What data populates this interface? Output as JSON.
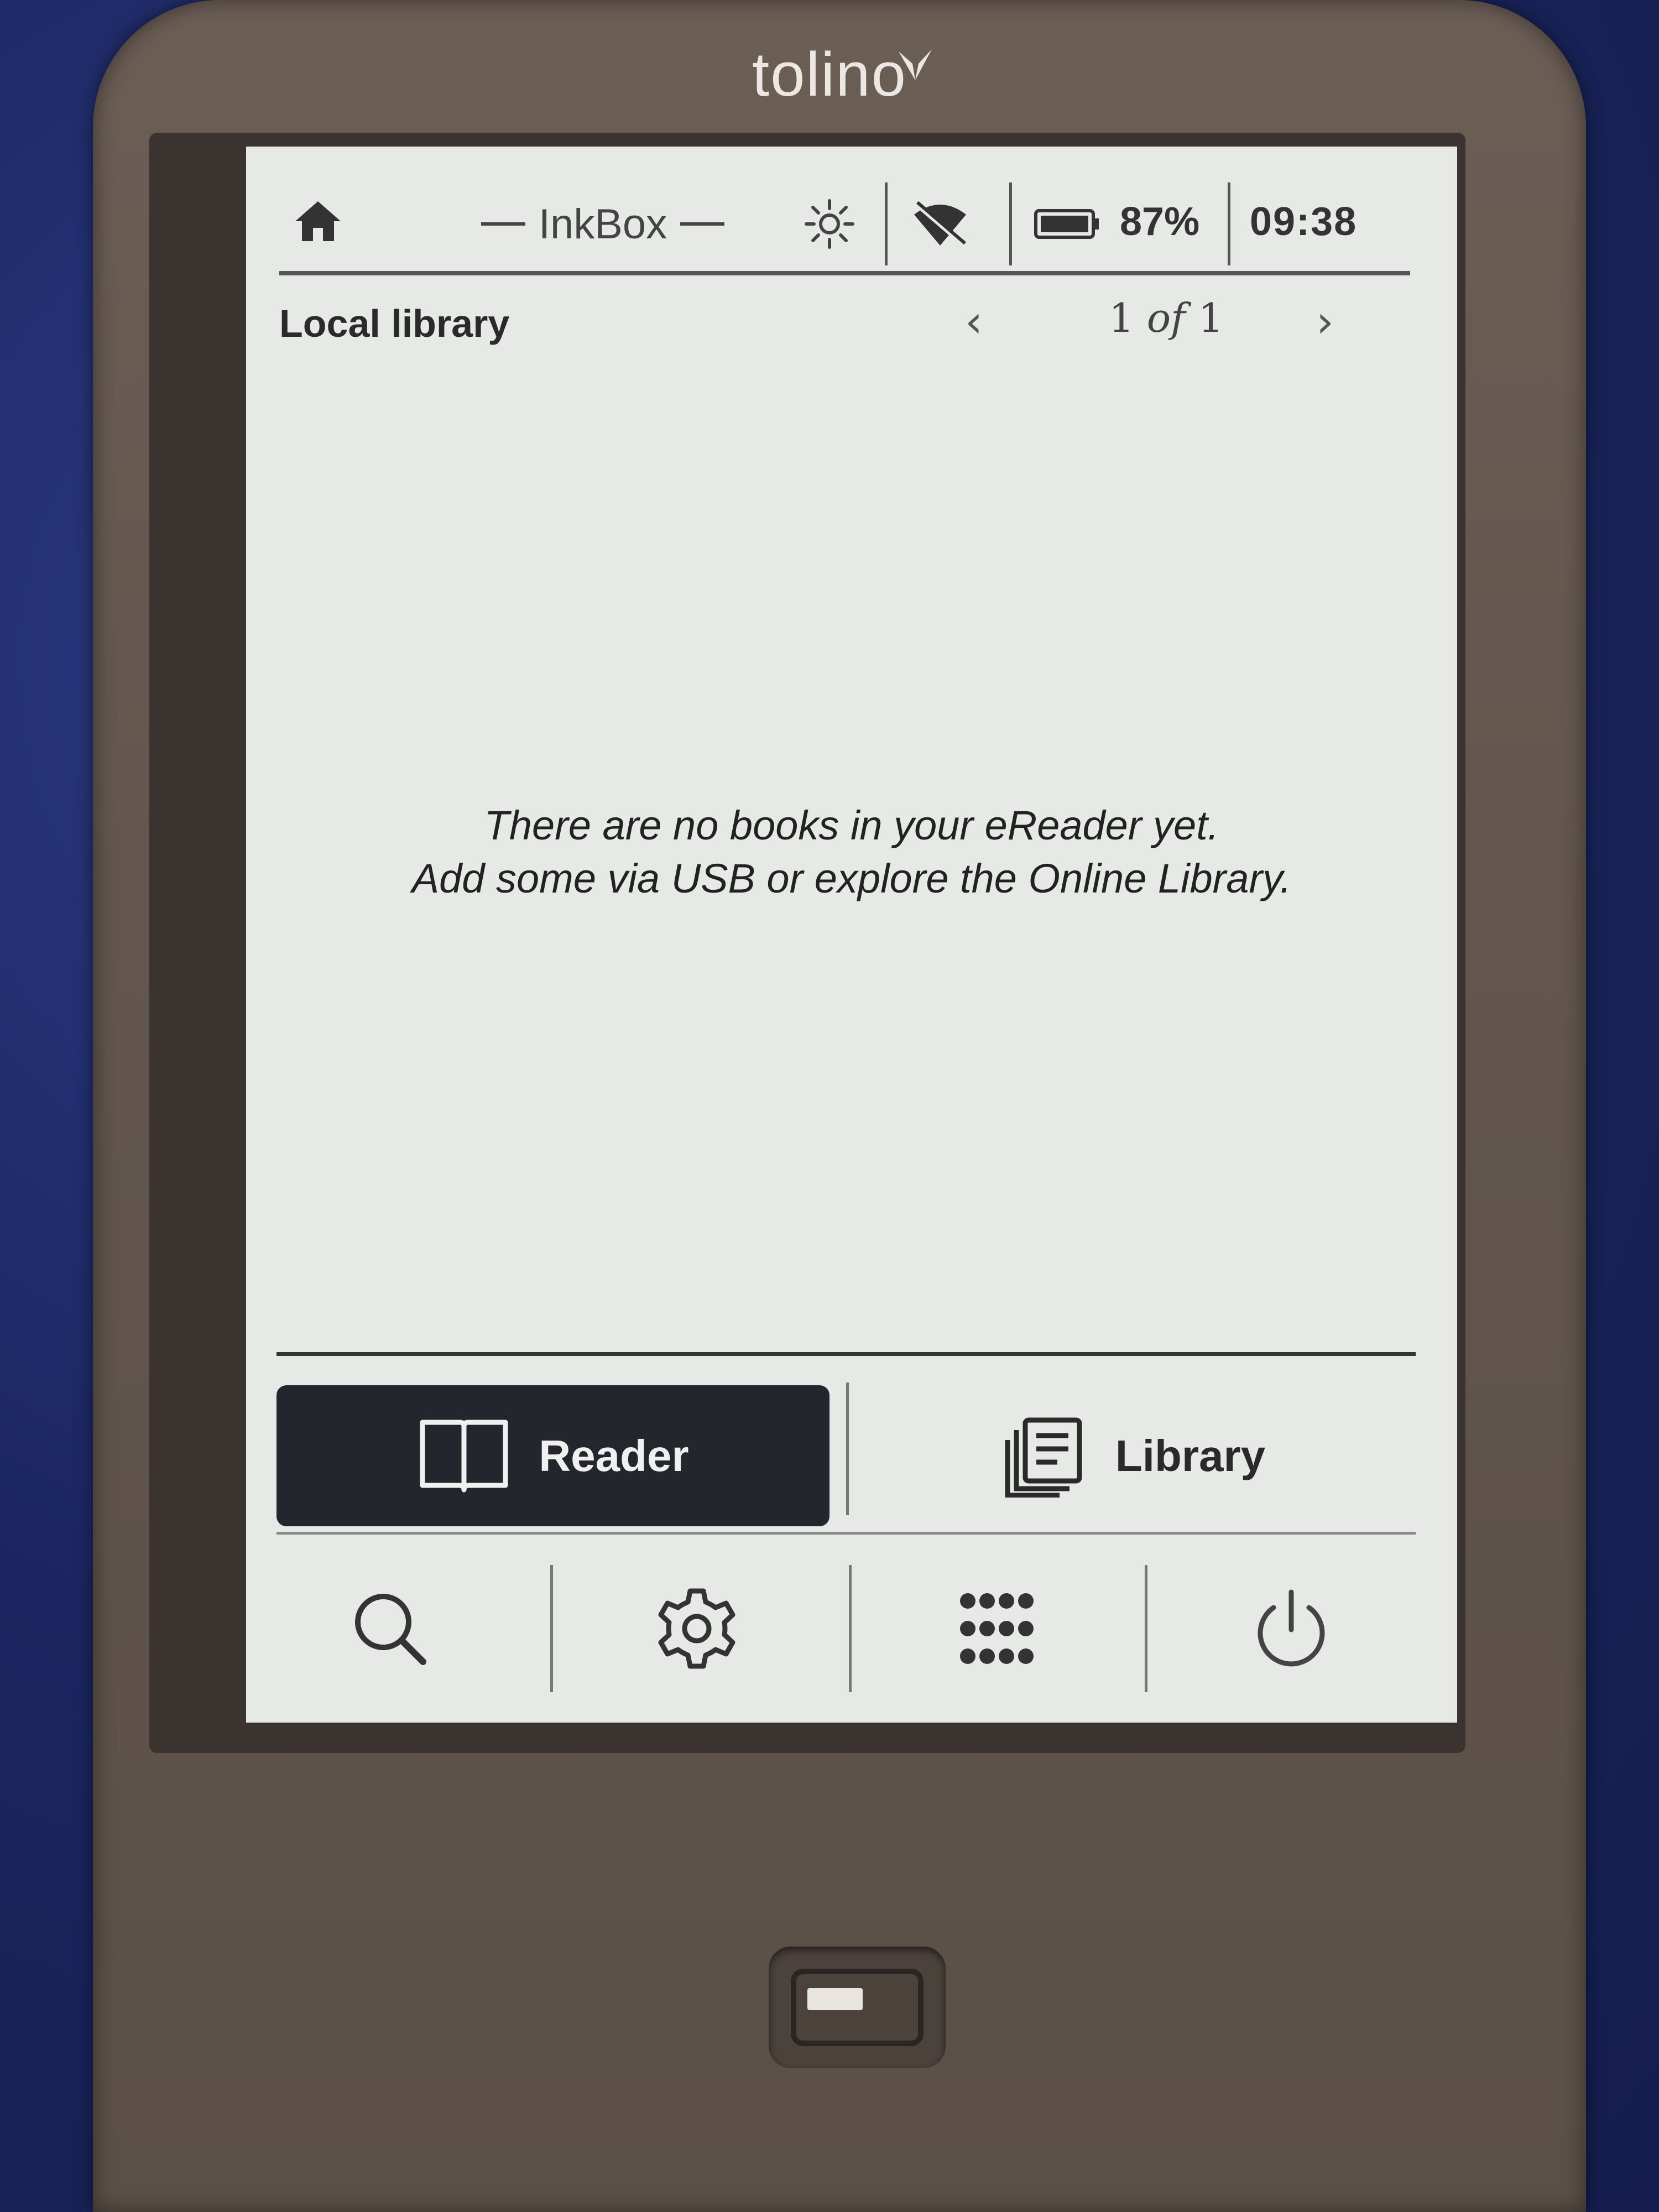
{
  "device": {
    "brand": "tolino"
  },
  "status_bar": {
    "app_title": "InkBox",
    "battery_percent": "87%",
    "clock": "09:38",
    "icons": [
      "home-icon",
      "brightness-icon",
      "wifi-off-icon",
      "battery-icon"
    ]
  },
  "library": {
    "title": "Local library",
    "page_current": "1",
    "page_of": "of",
    "page_total": "1",
    "prev_glyph": "‹",
    "next_glyph": "›",
    "empty_line1": "There are no books in your eReader yet.",
    "empty_line2": "Add some via USB or explore the Online Library."
  },
  "tabs": [
    {
      "label": "Reader",
      "icon": "open-book-icon",
      "active": true
    },
    {
      "label": "Library",
      "icon": "library-icon",
      "active": false
    }
  ],
  "actions": [
    {
      "icon": "search-icon"
    },
    {
      "icon": "gear-icon"
    },
    {
      "icon": "apps-grid-icon"
    },
    {
      "icon": "power-icon"
    }
  ],
  "colors": {
    "screen_bg": "#e6e9e6",
    "active_tab_bg": "#24262d",
    "device_body": "#62564e"
  }
}
